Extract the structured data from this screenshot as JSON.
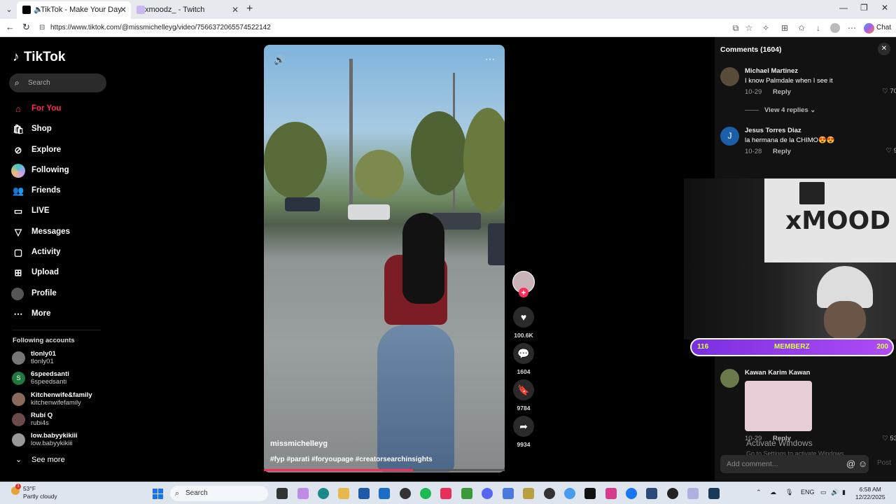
{
  "browser": {
    "tabs": [
      {
        "title": "TikTok - Make Your Day",
        "active": true
      },
      {
        "title": "xmoodz_ - Twitch",
        "active": false
      }
    ],
    "url": "https://www.tiktok.com/@missmichelleyg/video/7566372065574522142",
    "chat_label": "Chat"
  },
  "sidebar": {
    "brand": "TikTok",
    "search_placeholder": "Search",
    "nav": [
      {
        "label": "For You",
        "icon": "home-icon",
        "active": true
      },
      {
        "label": "Shop",
        "icon": "shop-icon"
      },
      {
        "label": "Explore",
        "icon": "compass-icon"
      },
      {
        "label": "Following",
        "icon": "following-avatar-icon"
      },
      {
        "label": "Friends",
        "icon": "friends-icon"
      },
      {
        "label": "LIVE",
        "icon": "live-icon"
      },
      {
        "label": "Messages",
        "icon": "messages-icon"
      },
      {
        "label": "Activity",
        "icon": "activity-icon"
      },
      {
        "label": "Upload",
        "icon": "upload-icon"
      },
      {
        "label": "Profile",
        "icon": "profile-avatar-icon"
      },
      {
        "label": "More",
        "icon": "more-icon"
      }
    ],
    "following_title": "Following accounts",
    "following": [
      {
        "name": "tlonly01",
        "handle": "tlonly01",
        "initial": ""
      },
      {
        "name": "6speedsanti",
        "handle": "6speedsanti",
        "initial": "S"
      },
      {
        "name": "Kitchenwife&family",
        "handle": "kitchenwifefamily",
        "initial": ""
      },
      {
        "name": "Rubí Q",
        "handle": "rubi4s",
        "initial": ""
      },
      {
        "name": "low.babyykikiii",
        "handle": "low.babyykikiii",
        "initial": ""
      }
    ],
    "see_more": "See more"
  },
  "video": {
    "username": "missmichelleyg",
    "hashtags": "#fyp #parati #foryoupage #creatorsearchinsights",
    "progress": 0.62,
    "likes": "100.6K",
    "comments": "1604",
    "saves": "9784",
    "shares": "9934"
  },
  "comments": {
    "title": "Comments (1604)",
    "items": [
      {
        "user": "Michael Martinez",
        "text": "I know Palmdale when I see it",
        "date": "10-29",
        "likes": "70",
        "reply_label": "Reply"
      },
      {
        "user": "Jesus Torres Diaz",
        "text": "la hermana de la CHIMO😍😍",
        "date": "10-28",
        "likes": "9",
        "reply_label": "Reply",
        "initial": "J"
      },
      {
        "user": "Kawan Karim Kawan",
        "text": "",
        "date": "10-29",
        "likes": "53",
        "reply_label": "Reply"
      }
    ],
    "view_replies": "View 4 replies",
    "add_placeholder": "Add comment...",
    "post_label": "Post",
    "watermark_title": "Activate Windows",
    "watermark_sub": "Go to Settings to activate Windows."
  },
  "overlay": {
    "left": "116",
    "center": "MEMBERZ",
    "right": "200"
  },
  "taskbar": {
    "temp": "53°F",
    "weather": "Partly cloudy",
    "weather_badge": "1",
    "search_placeholder": "Search",
    "lang": "ENG",
    "time": "6:58 AM",
    "date": "12/22/2025"
  },
  "colors": {
    "accent": "#fe2c55",
    "panel": "#121212",
    "members_bar": "#9a3ff0"
  }
}
